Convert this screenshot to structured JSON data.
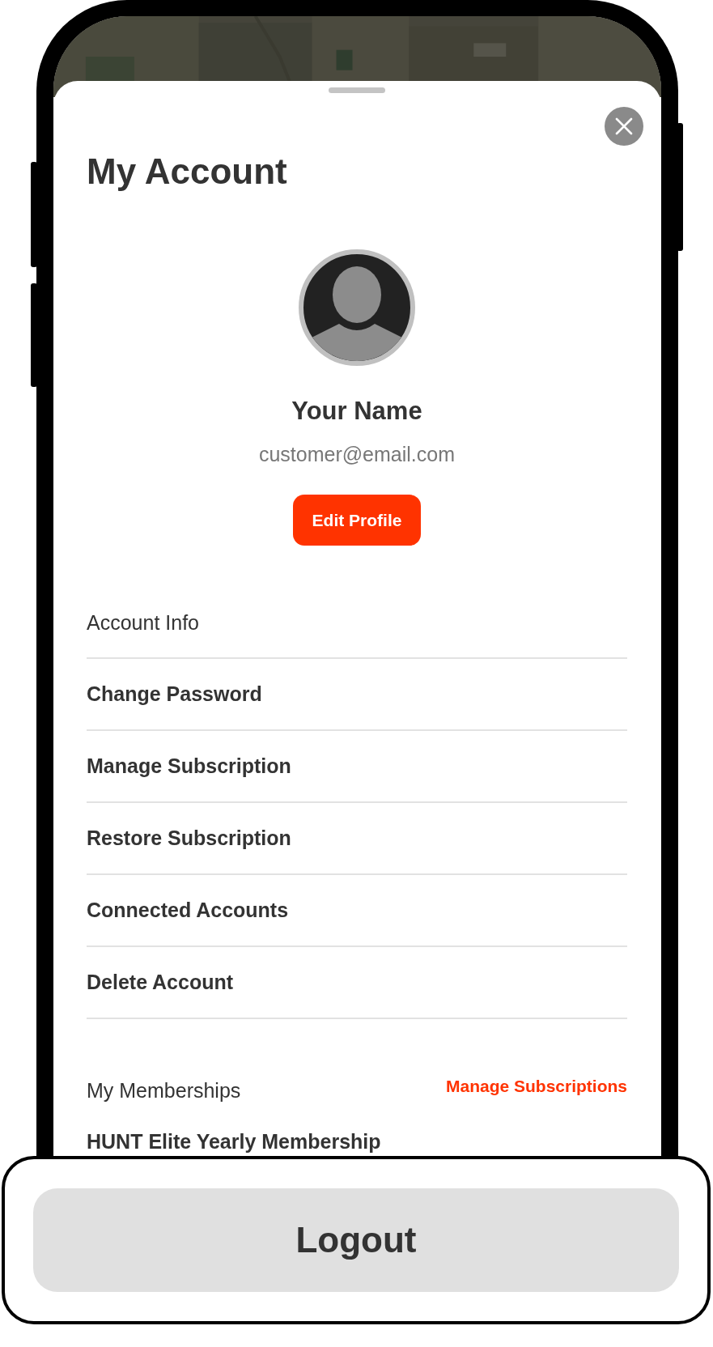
{
  "sheet": {
    "title": "My Account"
  },
  "profile": {
    "name": "Your Name",
    "email": "customer@email.com",
    "edit_button": "Edit Profile"
  },
  "account_info": {
    "heading": "Account Info",
    "items": [
      {
        "label": "Change Password"
      },
      {
        "label": "Manage Subscription"
      },
      {
        "label": "Restore Subscription"
      },
      {
        "label": "Connected Accounts"
      },
      {
        "label": "Delete Account"
      }
    ]
  },
  "memberships": {
    "heading": "My Memberships",
    "action": "Manage Subscriptions",
    "items": [
      {
        "label": "HUNT Elite Yearly Membership"
      }
    ]
  },
  "logout_button": "Logout"
}
